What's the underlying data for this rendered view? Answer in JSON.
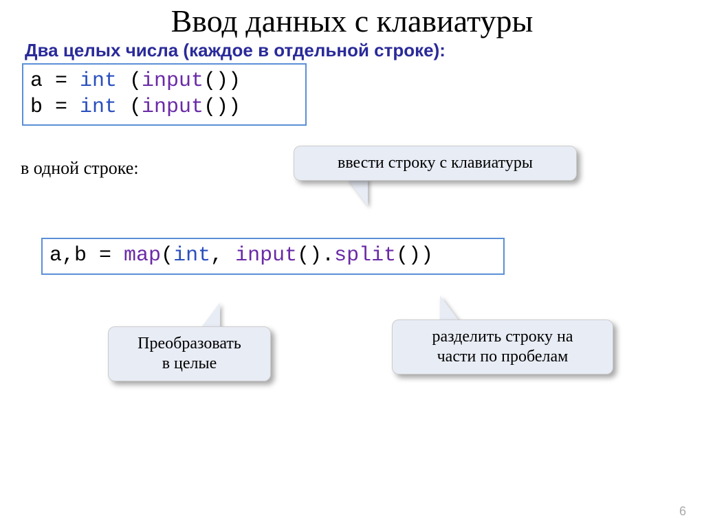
{
  "title": "Ввод данных с клавиатуры",
  "subtitle": "Два целых числа (каждое в отдельной строке):",
  "code_block_1": {
    "line1": {
      "var": "a = ",
      "kw": "int",
      "paren": " (",
      "fn": "input",
      "rest": "())"
    },
    "line2": {
      "var": "b = ",
      "kw": "int",
      "paren": " (",
      "fn": "input",
      "rest": "())"
    }
  },
  "label_one_line": "в одной строке:",
  "callout_input": "ввести строку с клавиатуры",
  "code_block_2": {
    "pre": "a,b = ",
    "map": "map",
    "open": "(",
    "int": "int",
    "comma": ", ",
    "input": "input",
    "mid": "().",
    "split": "split",
    "end": "())"
  },
  "callout_convert_l1": "Преобразовать",
  "callout_convert_l2": "в целые",
  "callout_split_l1": "разделить строку на",
  "callout_split_l2": "части по пробелам",
  "page": "6"
}
